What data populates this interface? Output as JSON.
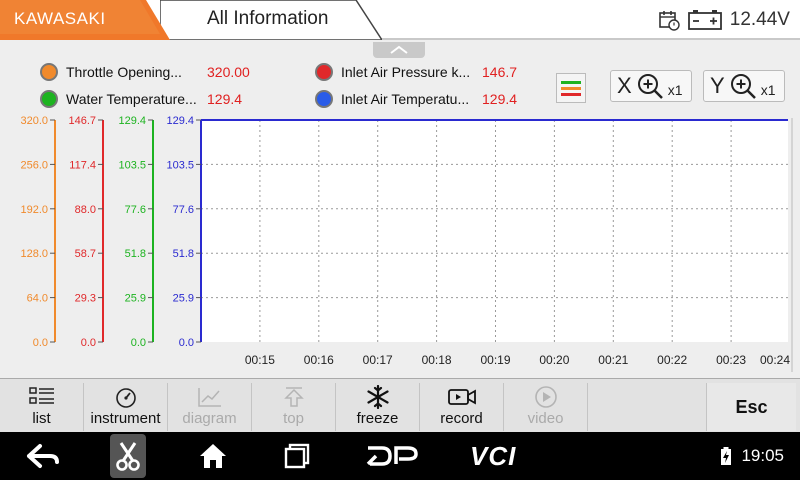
{
  "header": {
    "brand": "KAWASAKI",
    "section": "All Information",
    "voltage": "12.44V"
  },
  "legend": [
    {
      "label": "Throttle Opening...",
      "value": "320.00",
      "color": "#f08a2c"
    },
    {
      "label": "Inlet Air Pressure  k...",
      "value": "146.7",
      "color": "#e0282a"
    },
    {
      "label": "Water Temperature...",
      "value": "129.4",
      "color": "#1db320"
    },
    {
      "label": "Inlet Air Temperatu...",
      "value": "129.4",
      "color": "#2a5ce8"
    }
  ],
  "zoom": {
    "x_axis": "X",
    "x_mult": "x1",
    "y_axis": "Y",
    "y_mult": "x1"
  },
  "chart_data": {
    "type": "line",
    "x_ticks": [
      "00:15",
      "00:16",
      "00:17",
      "00:18",
      "00:19",
      "00:20",
      "00:21",
      "00:22",
      "00:23",
      "00:24"
    ],
    "axes": [
      {
        "color": "#f08a2c",
        "ticks": [
          "320.0",
          "256.0",
          "192.0",
          "128.0",
          "64.0",
          "0.0"
        ],
        "max": 320.0
      },
      {
        "color": "#e0282a",
        "ticks": [
          "146.7",
          "117.4",
          "88.0",
          "58.7",
          "29.3",
          "0.0"
        ],
        "max": 146.7
      },
      {
        "color": "#1db320",
        "ticks": [
          "129.4",
          "103.5",
          "77.6",
          "51.8",
          "25.9",
          "0.0"
        ],
        "max": 129.4
      },
      {
        "color": "#2a2ad0",
        "ticks": [
          "129.4",
          "103.5",
          "77.6",
          "51.8",
          "25.9",
          "0.0"
        ],
        "max": 129.4
      }
    ],
    "series": [
      {
        "axis": 3,
        "color": "#2a2ad0",
        "constant_value": 129.4
      }
    ],
    "grid": true
  },
  "toolbar": {
    "items": [
      {
        "label": "list",
        "enabled": true
      },
      {
        "label": "instrument",
        "enabled": true
      },
      {
        "label": "diagram",
        "enabled": false
      },
      {
        "label": "top",
        "enabled": false
      },
      {
        "label": "freeze",
        "enabled": true
      },
      {
        "label": "record",
        "enabled": true
      },
      {
        "label": "video",
        "enabled": false
      }
    ],
    "esc_label": "Esc"
  },
  "navbar": {
    "logo1": "DP",
    "logo2": "VCI",
    "time": "19:05"
  }
}
